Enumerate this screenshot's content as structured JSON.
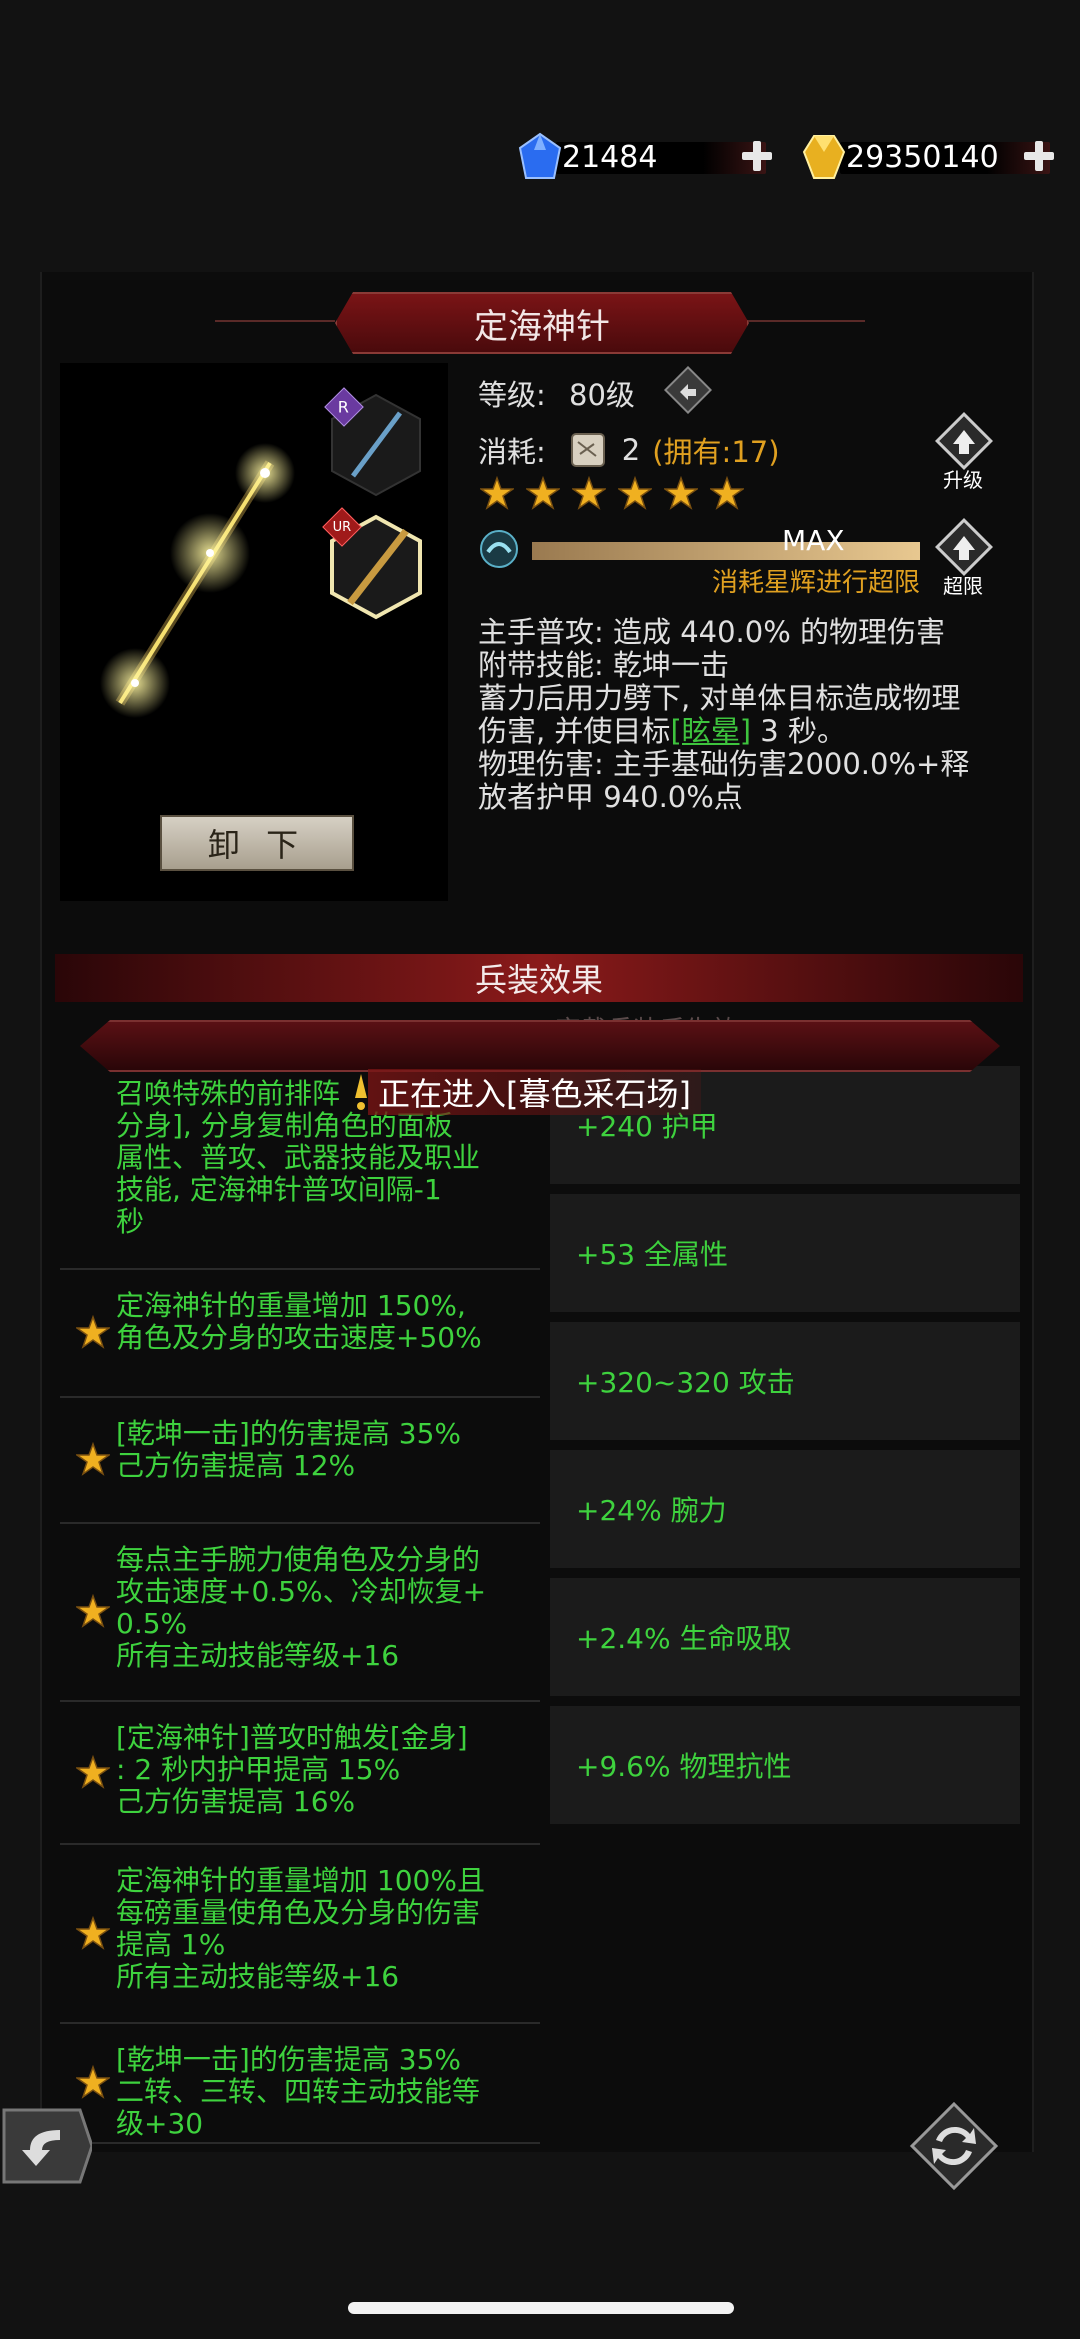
{
  "currency": {
    "gem": {
      "value": "21484",
      "icon": "blue-gem-icon",
      "color": "#2a6cf0"
    },
    "gold": {
      "value": "29350140",
      "icon": "gold-crystal-icon",
      "color": "#e8b020"
    }
  },
  "item": {
    "name": "定海神针",
    "level_label": "等级:",
    "level_value": "80级",
    "cost_label": "消耗:",
    "cost_value": "2",
    "cost_owned": "(拥有:17)",
    "stars": 6,
    "progress_label": "MAX",
    "progress_sub": "消耗星辉进行超限",
    "upgrade_label": "升级",
    "limit_label": "超限",
    "unequip_label": "卸 下",
    "slot1_rarity": "R",
    "slot2_rarity": "UR",
    "desc": {
      "line1": "主手普攻: 造成 440.0% 的物理伤害",
      "line2": "附带技能: 乾坤一击",
      "line3": "蓄力后用力劈下, 对单体目标造成物理",
      "line4_a": "伤害, 并使目标",
      "line4_link": "[眩晕]",
      "line4_b": " 3 秒。",
      "line5": "物理伤害: 主手基础伤害2000.0%+释",
      "line6": "放者护甲 940.0%点"
    }
  },
  "effects": {
    "title": "兵装效果",
    "faded_note": "穿戴兵装后生效:",
    "toast": "正在进入[暮色采石场]",
    "list": [
      {
        "lines": [
          "召唤特殊的前排阵",
          "分身], 分身复制角色的面板",
          "属性、普攻、武器技能及职业",
          "技能, 定海神针普攻间隔-1",
          "秒"
        ]
      },
      {
        "lines": [
          "定海神针的重量增加 150%,",
          "角色及分身的攻击速度+50%"
        ]
      },
      {
        "lines": [
          "[乾坤一击]的伤害提高 35%",
          "己方伤害提高 12%"
        ]
      },
      {
        "lines": [
          "每点主手腕力使角色及分身的",
          "攻击速度+0.5%、冷却恢复+",
          "0.5%",
          "所有主动技能等级+16"
        ]
      },
      {
        "lines": [
          "[定海神针]普攻时触发[金身]",
          ": 2 秒内护甲提高 15%",
          "己方伤害提高 16%"
        ]
      },
      {
        "lines": [
          "定海神针的重量增加 100%且",
          "每磅重量使角色及分身的伤害",
          "提高 1%",
          "所有主动技能等级+16"
        ]
      },
      {
        "lines": [
          "[乾坤一击]的伤害提高 35%",
          "二转、三转、四转主动技能等",
          "级+30"
        ]
      }
    ],
    "stats": [
      "+240 护甲",
      "+53 全属性",
      "+320~320 攻击",
      "+24% 腕力",
      "+2.4% 生命吸取",
      "+9.6% 物理抗性"
    ]
  }
}
